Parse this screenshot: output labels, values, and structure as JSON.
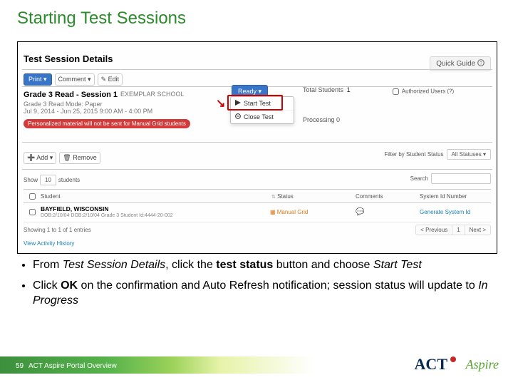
{
  "title": "Starting Test Sessions",
  "screenshot": {
    "header": "Test Session Details",
    "quick_guide": "Quick Guide",
    "print_btn": "Print ▾",
    "comment_btn": "Comment ▾",
    "edit_btn": "✎ Edit",
    "session_name": "Grade 3 Read - Session 1",
    "mode": "Grade 3 Read   Mode: Paper",
    "school": "EXEMPLAR SCHOOL",
    "dates": "Jul 9, 2014 - Jun 25, 2015   9:00 AM - 4:00 PM",
    "red_note": "Personalized material will not be sent for Manual Grid students",
    "ready_btn": "Ready ▾",
    "menu_start": "Start Test",
    "menu_close": "Close Test",
    "total_students_label": "Total Students",
    "total_students_val": "1",
    "authorized_users": "Authorized Users (?)",
    "processing_label": "Processing",
    "processing_val": "0",
    "add_btn": "Add ▾",
    "remove_btn": "Remove",
    "filter_label": "Filter by Student Status",
    "filter_value": "All Statuses ▾",
    "show_label": "Show",
    "show_value": "10",
    "show_label2": "students",
    "search_label": "Search",
    "cols": {
      "student": "Student",
      "status": "Status",
      "comments": "Comments",
      "sysid": "System Id Number"
    },
    "row": {
      "name": "BAYFIELD, WISCONSIN",
      "meta": "DOB:2/10/04   DOB:2/10/04   Grade 3   Student Id:4444-20-002",
      "status": "Manual Grid",
      "sysid": "Generate System Id"
    },
    "showing": "Showing 1 to 1 of 1 entries",
    "pager_prev": "< Previous",
    "pager_page": "1",
    "pager_next": "Next >",
    "view_history": "View Activity History"
  },
  "bullets": {
    "b1_pre": "From ",
    "b1_em1": "Test Session Details",
    "b1_mid": ", click the ",
    "b1_strong": "test status",
    "b1_mid2": " button and choose ",
    "b1_em2": "Start Test",
    "b2_pre": "Click ",
    "b2_strong": "OK",
    "b2_mid": " on the confirmation and Auto Refresh notification; session status will update to ",
    "b2_em": "In Progress"
  },
  "footer": {
    "num": "59",
    "text": "ACT Aspire Portal Overview",
    "act": "ACT",
    "aspire": "Aspire"
  }
}
